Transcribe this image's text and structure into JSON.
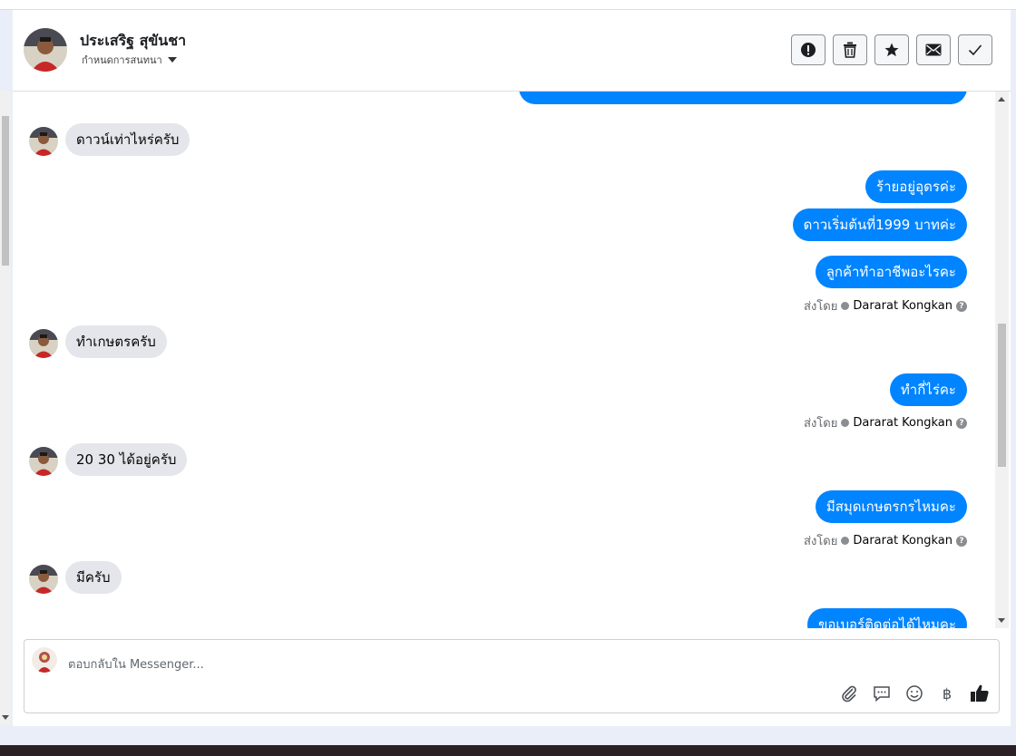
{
  "header": {
    "contact_name": "ประเสริฐ สุขันชา",
    "subtitle": "กำหนดการสนทนา",
    "actions": [
      {
        "name": "report-icon",
        "glyph": "!"
      },
      {
        "name": "trash-icon",
        "glyph": "🗑"
      },
      {
        "name": "star-icon",
        "glyph": "★"
      },
      {
        "name": "mail-icon",
        "glyph": "✉"
      },
      {
        "name": "check-icon",
        "glyph": "✓"
      }
    ]
  },
  "messages": {
    "m1": "ดาวน์เท่าไหร่ครับ",
    "m2": "ร้ายอยู่อุดรค่ะ",
    "m3": "ดาวเริ่มต้นที่1999 บาทค่ะ",
    "m4": "ลูกค้าทำอาชีพอะไรคะ",
    "sent_by_label": "ส่งโดย",
    "sent_by_name": "Dararat Kongkan",
    "m5": "ทำเกษตรครับ",
    "m6": "ทำกี่ไร่คะ",
    "m7": "20 30 ได้อยู่ครับ",
    "m8": "มีสมุดเกษตรกรไหมคะ",
    "m9": "มีครับ",
    "m10": "ขอเบอร์ติดต่อได้ไหมคะ"
  },
  "composer": {
    "placeholder": "ตอบกลับใน Messenger...",
    "tools": [
      "paperclip-icon",
      "chat-bubble-icon",
      "emoji-icon",
      "baht-icon",
      "thumbs-up-icon"
    ],
    "baht_glyph": "฿"
  },
  "colors": {
    "outgoing": "#0084ff",
    "incoming": "#e4e6eb"
  }
}
